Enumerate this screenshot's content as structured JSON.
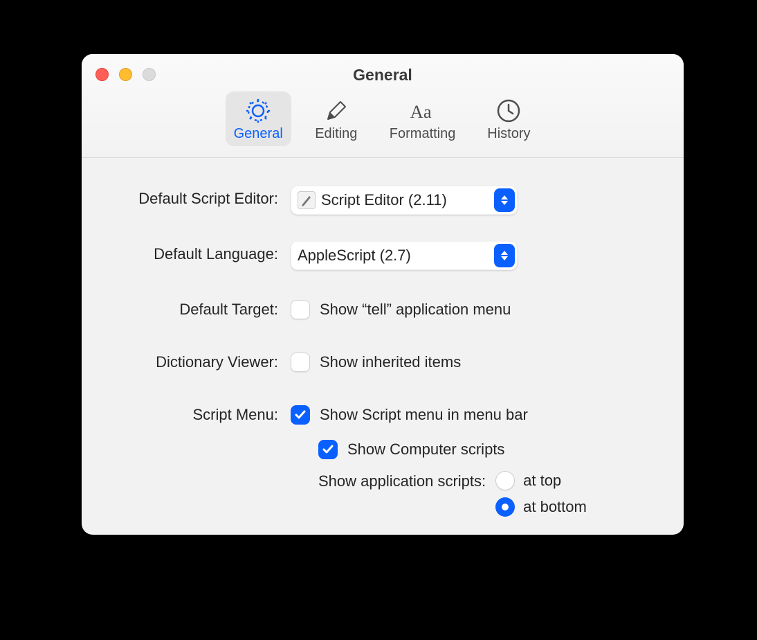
{
  "window": {
    "title": "General"
  },
  "toolbar": {
    "items": [
      {
        "label": "General"
      },
      {
        "label": "Editing"
      },
      {
        "label": "Formatting"
      },
      {
        "label": "History"
      }
    ]
  },
  "fields": {
    "default_script_editor": {
      "label": "Default Script Editor:",
      "value": "Script Editor (2.11)"
    },
    "default_language": {
      "label": "Default Language:",
      "value": "AppleScript (2.7)"
    },
    "default_target": {
      "label": "Default Target:",
      "checkbox_label": "Show “tell” application menu",
      "checked": false
    },
    "dictionary_viewer": {
      "label": "Dictionary Viewer:",
      "checkbox_label": "Show inherited items",
      "checked": false
    },
    "script_menu": {
      "label": "Script Menu:",
      "show_menu_label": "Show Script menu in menu bar",
      "show_menu_checked": true,
      "show_computer_label": "Show Computer scripts",
      "show_computer_checked": true,
      "show_app_scripts_label": "Show application scripts:",
      "radio": {
        "top_label": "at top",
        "bottom_label": "at bottom",
        "selected": "bottom"
      }
    }
  }
}
